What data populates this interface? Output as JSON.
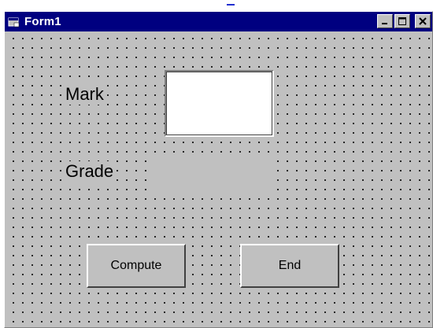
{
  "window": {
    "title": "Form1",
    "titlebar_color": "#000080",
    "background_color": "#c0c0c0",
    "controls": {
      "minimize_icon": "minimize-icon",
      "maximize_icon": "maximize-icon",
      "close_icon": "close-icon"
    }
  },
  "form": {
    "mark_label": "Mark",
    "grade_label": "Grade",
    "mark_input_value": "",
    "grade_value": ""
  },
  "buttons": {
    "compute_label": "Compute",
    "end_label": "End"
  }
}
